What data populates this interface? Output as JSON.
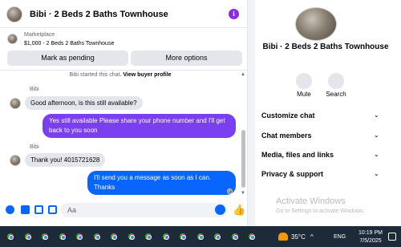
{
  "header": {
    "title": "Bibi · 2 Beds 2 Baths Townhouse",
    "info_glyph": "i"
  },
  "listing": {
    "marketplace_label": "Marketplace",
    "price_line": "$1,000 - 2 Beds 2 Baths Townhouse",
    "pending_button": "Mark as pending",
    "options_button": "More options"
  },
  "messages": {
    "started_text": "Bibi started this chat.",
    "started_link": "View buyer profile",
    "items": [
      {
        "sender": "Bibi",
        "text": "Good afternoon, is this still available?"
      },
      {
        "text": "Yes still available Please share your phone number and I'll get back to you soon"
      },
      {
        "sender": "Bibi",
        "text": "Thank you! 4015721628"
      },
      {
        "text": "I'll send you a message as soon as I can. Thanks"
      }
    ]
  },
  "composer": {
    "placeholder": "Aa"
  },
  "info_panel": {
    "name": "Bibi · 2 Beds 2 Baths Townhouse",
    "mute_label": "Mute",
    "search_label": "Search",
    "sections": [
      "Customize chat",
      "Chat members",
      "Media, files and links",
      "Privacy & support"
    ]
  },
  "watermark": {
    "title": "Activate Windows",
    "subtitle": "Go to Settings to activate Windows."
  },
  "taskbar": {
    "temperature": "35°C",
    "language": "ENG",
    "time": "10:19 PM",
    "date": "7/5/2025"
  },
  "colors": {
    "accent": "#0866ff",
    "purple_bubble": "#7b3ff2",
    "blue_bubble": "#0866ff",
    "taskbar": "#1d2a3a"
  }
}
